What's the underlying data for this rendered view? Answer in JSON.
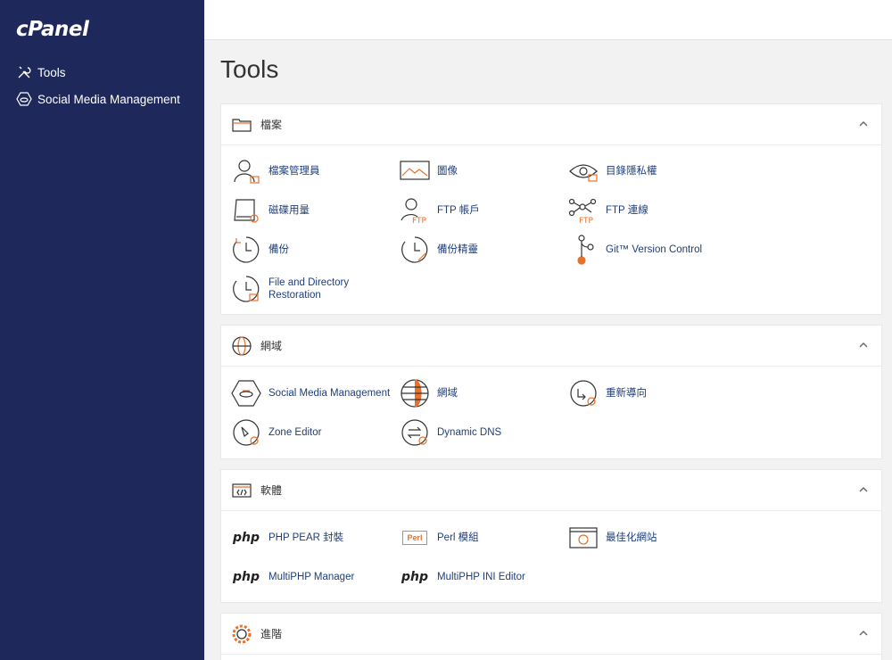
{
  "app": {
    "logo": "cPanel"
  },
  "sidebar": {
    "items": [
      {
        "label": "Tools",
        "icon": "tools-icon"
      },
      {
        "label": "Social Media Management",
        "icon": "social-media-icon"
      }
    ]
  },
  "main": {
    "title": "Tools",
    "sections": [
      {
        "title": "檔案",
        "icon": "folder-icon",
        "items": [
          {
            "label": "檔案管理員",
            "icon": "file-manager-icon"
          },
          {
            "label": "圖像",
            "icon": "image-icon"
          },
          {
            "label": "目錄隱私權",
            "icon": "eye-icon"
          },
          {
            "label": "磁碟用量",
            "icon": "disk-icon"
          },
          {
            "label": "FTP 帳戶",
            "icon": "ftp-account-icon"
          },
          {
            "label": "FTP 連線",
            "icon": "ftp-connection-icon"
          },
          {
            "label": "備份",
            "icon": "backup-icon"
          },
          {
            "label": "備份精靈",
            "icon": "backup-wizard-icon"
          },
          {
            "label": "Git™ Version Control",
            "icon": "git-icon"
          },
          {
            "label_line1": "File and Directory",
            "label_line2": "Restoration",
            "icon": "restore-icon"
          }
        ]
      },
      {
        "title": "網域",
        "icon": "globe-icon",
        "items": [
          {
            "label": "Social Media Management",
            "icon": "social-media-icon"
          },
          {
            "label": "網域",
            "icon": "globe-icon"
          },
          {
            "label": "重新導向",
            "icon": "redirect-icon"
          },
          {
            "label": "Zone Editor",
            "icon": "zone-editor-icon"
          },
          {
            "label": "Dynamic DNS",
            "icon": "dynamic-dns-icon"
          }
        ]
      },
      {
        "title": "軟體",
        "icon": "code-window-icon",
        "items": [
          {
            "label": "PHP PEAR 封裝",
            "icon": "php-pear-icon",
            "icon_text": "php"
          },
          {
            "label": "Perl 模組",
            "icon": "perl-icon",
            "icon_text": "Perl"
          },
          {
            "label": "最佳化網站",
            "icon": "optimize-icon"
          },
          {
            "label": "MultiPHP Manager",
            "icon": "multiphp-manager-icon",
            "icon_text": "php"
          },
          {
            "label": "MultiPHP INI Editor",
            "icon": "multiphp-ini-icon",
            "icon_text": "php"
          }
        ]
      },
      {
        "title": "進階",
        "icon": "gear-icon",
        "items": []
      }
    ]
  },
  "colors": {
    "sidebar": "#1f285a",
    "accent": "#e8702a",
    "link": "#1f3f77"
  }
}
